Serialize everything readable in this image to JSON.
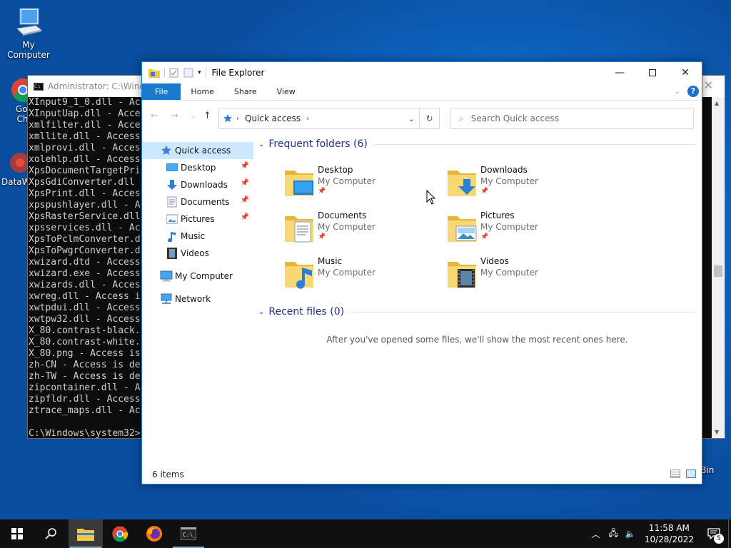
{
  "desktop": {
    "icons": [
      {
        "label": "My Computer"
      },
      {
        "label": "Goo Chr"
      },
      {
        "label": "DataW"
      }
    ],
    "recycle_bin_label": "e Bin"
  },
  "cmd": {
    "title": "Administrator: C:\\Windo",
    "lines": [
      "XInput9_1_0.dll - Acc",
      "XInputUap.dll - Acce",
      "xmlfilter.dll - Acce",
      "xmllite.dll - Access",
      "xmlprovi.dll - Acces",
      "xolehlp.dll - Access",
      "XpsDocumentTargetPri",
      "XpsGdiConverter.dll",
      "XpsPrint.dll - Acces",
      "xpspushlayer.dll - A",
      "XpsRasterService.dll",
      "xpsservices.dll - Ac",
      "XpsToPclmConverter.d",
      "XpsToPwgrConverter.d",
      "xwizard.dtd - Access",
      "xwizard.exe - Access",
      "xwizards.dll - Acces",
      "xwreg.dll - Access i",
      "xwtpdui.dll - Access",
      "xwtpw32.dll - Access",
      "X_80.contrast-black.",
      "X_80.contrast-white.",
      "X_80.png - Access is",
      "zh-CN - Access is de",
      "zh-TW - Access is de",
      "zipcontainer.dll - A",
      "zipfldr.dll - Access",
      "ztrace_maps.dll - Ac",
      "",
      "C:\\Windows\\system32>"
    ]
  },
  "explorer": {
    "title": "File Explorer",
    "ribbon_tabs": [
      "File",
      "Home",
      "Share",
      "View"
    ],
    "address": {
      "location": "Quick access"
    },
    "search": {
      "placeholder": "Search Quick access"
    },
    "nav": [
      {
        "label": "Quick access",
        "icon": "star-icon",
        "selected": true,
        "pinned": false
      },
      {
        "label": "Desktop",
        "icon": "desktop-folder-icon",
        "pinned": true
      },
      {
        "label": "Downloads",
        "icon": "download-arrow-icon",
        "pinned": true
      },
      {
        "label": "Documents",
        "icon": "documents-icon",
        "pinned": true
      },
      {
        "label": "Pictures",
        "icon": "pictures-icon",
        "pinned": true
      },
      {
        "label": "Music",
        "icon": "music-note-icon",
        "pinned": false
      },
      {
        "label": "Videos",
        "icon": "video-film-icon",
        "pinned": false
      },
      {
        "label": "My Computer",
        "icon": "computer-icon",
        "pinned": false
      },
      {
        "label": "Network",
        "icon": "network-icon",
        "pinned": false
      }
    ],
    "frequent_header": "Frequent folders (6)",
    "frequent": [
      {
        "name": "Desktop",
        "location": "My Computer",
        "pinned": true,
        "icon": "desktop-folder-icon"
      },
      {
        "name": "Downloads",
        "location": "My Computer",
        "pinned": true,
        "icon": "downloads-folder-icon"
      },
      {
        "name": "Documents",
        "location": "My Computer",
        "pinned": true,
        "icon": "documents-folder-icon"
      },
      {
        "name": "Pictures",
        "location": "My Computer",
        "pinned": true,
        "icon": "pictures-folder-icon"
      },
      {
        "name": "Music",
        "location": "My Computer",
        "pinned": false,
        "icon": "music-folder-icon"
      },
      {
        "name": "Videos",
        "location": "My Computer",
        "pinned": false,
        "icon": "videos-folder-icon"
      }
    ],
    "recent_header": "Recent files (0)",
    "recent_empty": "After you've opened some files, we'll show the most recent ones here.",
    "status": "6 items"
  },
  "taskbar": {
    "time": "11:58 AM",
    "date": "10/28/2022",
    "notification_count": "5"
  },
  "colors": {
    "accent": "#1979ca",
    "selection": "#cce8ff",
    "section_header": "#1e3287"
  }
}
